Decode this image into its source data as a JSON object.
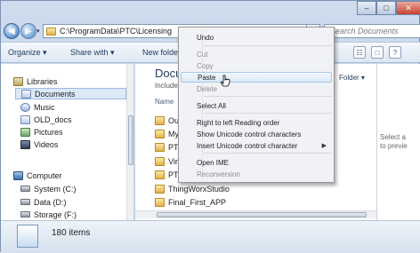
{
  "window": {
    "caption_min": "–",
    "caption_max": "□",
    "caption_close": "✕"
  },
  "nav": {
    "back_icon": "back-arrow-icon",
    "forward_icon": "forward-arrow-icon",
    "address_path": "C:\\ProgramData\\PTC\\Licensing",
    "search_placeholder": "Search Documents"
  },
  "toolbar": {
    "organize": "Organize ▾",
    "share_with": "Share with ▾",
    "new_folder": "New folder"
  },
  "sidebar": {
    "items": [
      {
        "label": "Libraries",
        "icon": "library-icon"
      },
      {
        "label": "Documents",
        "icon": "documents-icon"
      },
      {
        "label": "Music",
        "icon": "music-icon"
      },
      {
        "label": "OLD_docs",
        "icon": "documents-icon"
      },
      {
        "label": "Pictures",
        "icon": "pictures-icon"
      },
      {
        "label": "Videos",
        "icon": "videos-icon"
      },
      {
        "label": "Computer",
        "icon": "computer-icon"
      },
      {
        "label": "System (C:)",
        "icon": "drive-icon"
      },
      {
        "label": "Data (D:)",
        "icon": "drive-icon"
      },
      {
        "label": "Storage (F:)",
        "icon": "drive-icon"
      }
    ]
  },
  "content": {
    "library_title": "Docu",
    "library_sub": "Include",
    "arrange_by": "Folder ▾",
    "column_name": "Name",
    "files": [
      "Out",
      "My",
      "PTC",
      "Virt",
      "PTC",
      "ThingWorxStudio",
      "Final_First_APP"
    ]
  },
  "preview": {
    "line1": "Select a",
    "line2": "to previe"
  },
  "status": {
    "item_count": "180 items"
  },
  "context_menu": {
    "items": [
      {
        "label": "Undo",
        "enabled": true
      },
      {
        "label": "Cut",
        "enabled": false
      },
      {
        "label": "Copy",
        "enabled": false
      },
      {
        "label": "Paste",
        "enabled": true,
        "hover": true
      },
      {
        "label": "Delete",
        "enabled": false
      },
      {
        "label": "Select All",
        "enabled": true
      },
      {
        "label": "Right to left Reading order",
        "enabled": true
      },
      {
        "label": "Show Unicode control characters",
        "enabled": true
      },
      {
        "label": "Insert Unicode control character",
        "enabled": true,
        "submenu": true
      },
      {
        "label": "Open IME",
        "enabled": true
      },
      {
        "label": "Reconversion",
        "enabled": false
      }
    ]
  },
  "colors": {
    "accent": "#1e395b",
    "selection": "#dce9f8"
  }
}
